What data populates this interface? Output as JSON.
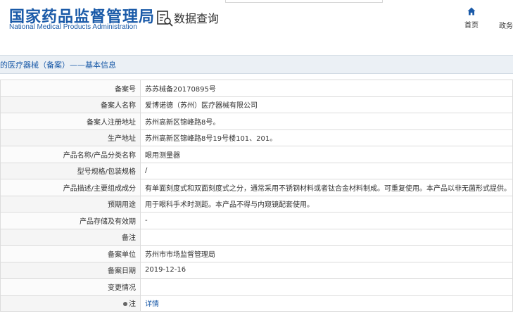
{
  "header": {
    "logo_cn": "国家药品监督管理局",
    "logo_en": "National Medical Products Administration",
    "query_label": "数据查询",
    "nav": {
      "home": "首页",
      "gov": "政务"
    }
  },
  "breadcrumb": "的医疗器械（备案）——基本信息",
  "colors": {
    "brand_blue": "#1a5aa8",
    "band_bg": "#ebf0f5",
    "border": "#dcdcdc"
  },
  "rows": [
    {
      "label": "备案号",
      "value": "苏苏械备20170895号"
    },
    {
      "label": "备案人名称",
      "value": "爱博诺德（苏州）医疗器械有限公司"
    },
    {
      "label": "备案人注册地址",
      "value": "苏州高新区锦峰路8号。"
    },
    {
      "label": "生产地址",
      "value": "苏州高新区锦峰路8号19号楼101、201。"
    },
    {
      "label": "产品名称/产品分类名称",
      "value": "眼用测量器"
    },
    {
      "label": "型号规格/包装规格",
      "value": "/"
    },
    {
      "label": "产品描述/主要组成成分",
      "value": "有单面刻度式和双面刻度式之分，通常采用不锈钢材料或者钛合金材料制成。可重复使用。本产品以非无菌形式提供。"
    },
    {
      "label": "预期用途",
      "value": "用于眼科手术时测距。本产品不得与内窥镜配套使用。"
    },
    {
      "label": "产品存储及有效期",
      "value": "-"
    },
    {
      "label": "备注",
      "value": ""
    },
    {
      "label": "备案单位",
      "value": "苏州市市场监督管理局"
    },
    {
      "label": "备案日期",
      "value": "2019-12-16"
    },
    {
      "label": "变更情况",
      "value": ""
    }
  ],
  "note_row": {
    "label": "注",
    "link": "详情",
    "icon": "bullet-icon"
  }
}
